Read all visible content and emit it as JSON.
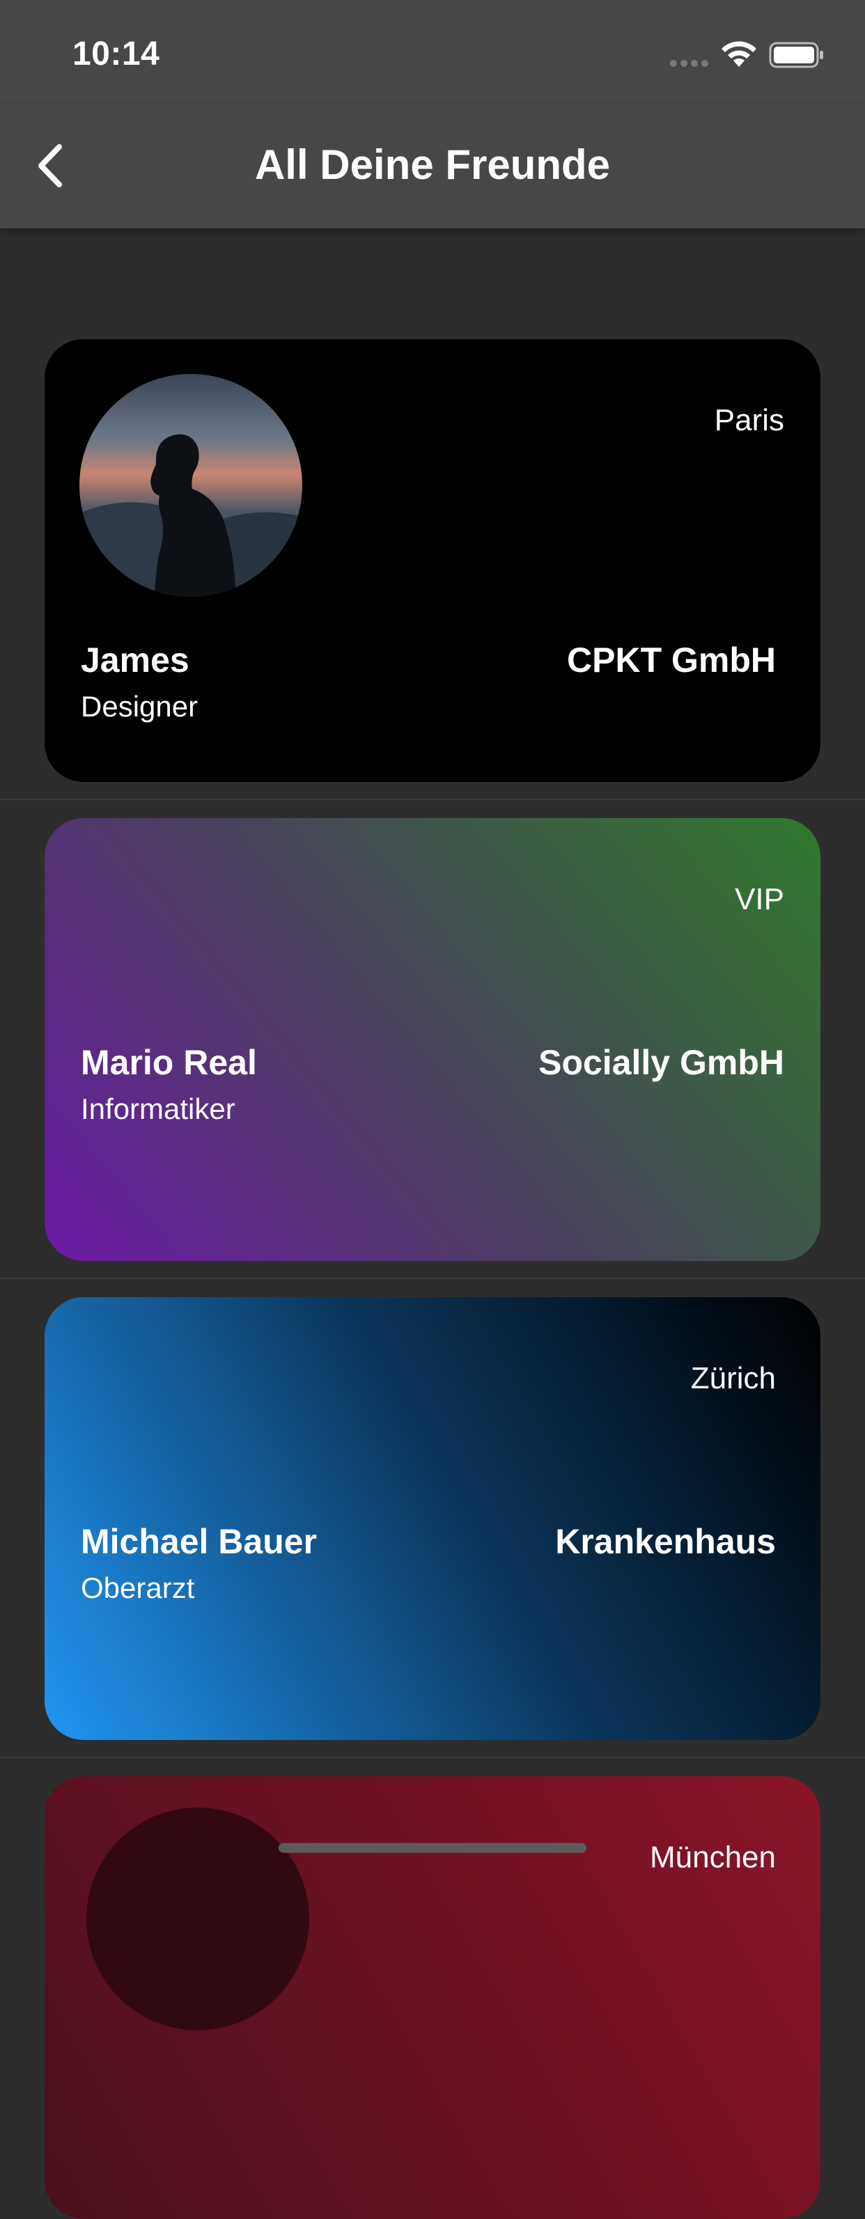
{
  "status_bar": {
    "time": "10:14",
    "icons": [
      "signal-icon",
      "wifi-icon",
      "battery-icon"
    ]
  },
  "nav": {
    "back_icon": "chevron-left-icon",
    "title": "All Deine Freunde"
  },
  "friends": [
    {
      "name": "James",
      "role": "Designer",
      "company": "CPKT GmbH",
      "tag": "Paris",
      "has_avatar": true
    },
    {
      "name": "Mario Real",
      "role": "Informatiker",
      "company": "Socially GmbH",
      "tag": "VIP"
    },
    {
      "name": "Michael Bauer",
      "role": "Oberarzt",
      "company": "Krankenhaus",
      "tag": "Zürich"
    },
    {
      "tag": "München",
      "has_avatar": true
    }
  ],
  "colors": {
    "bar": "#474747",
    "background": "#2d2d2d",
    "card_1": "#000000",
    "card_2_start": "#6b1aa5",
    "card_2_end": "#2f7a2c",
    "card_3_start": "#2196f3",
    "card_3_end": "#000000",
    "card_4": "#8a1428"
  }
}
